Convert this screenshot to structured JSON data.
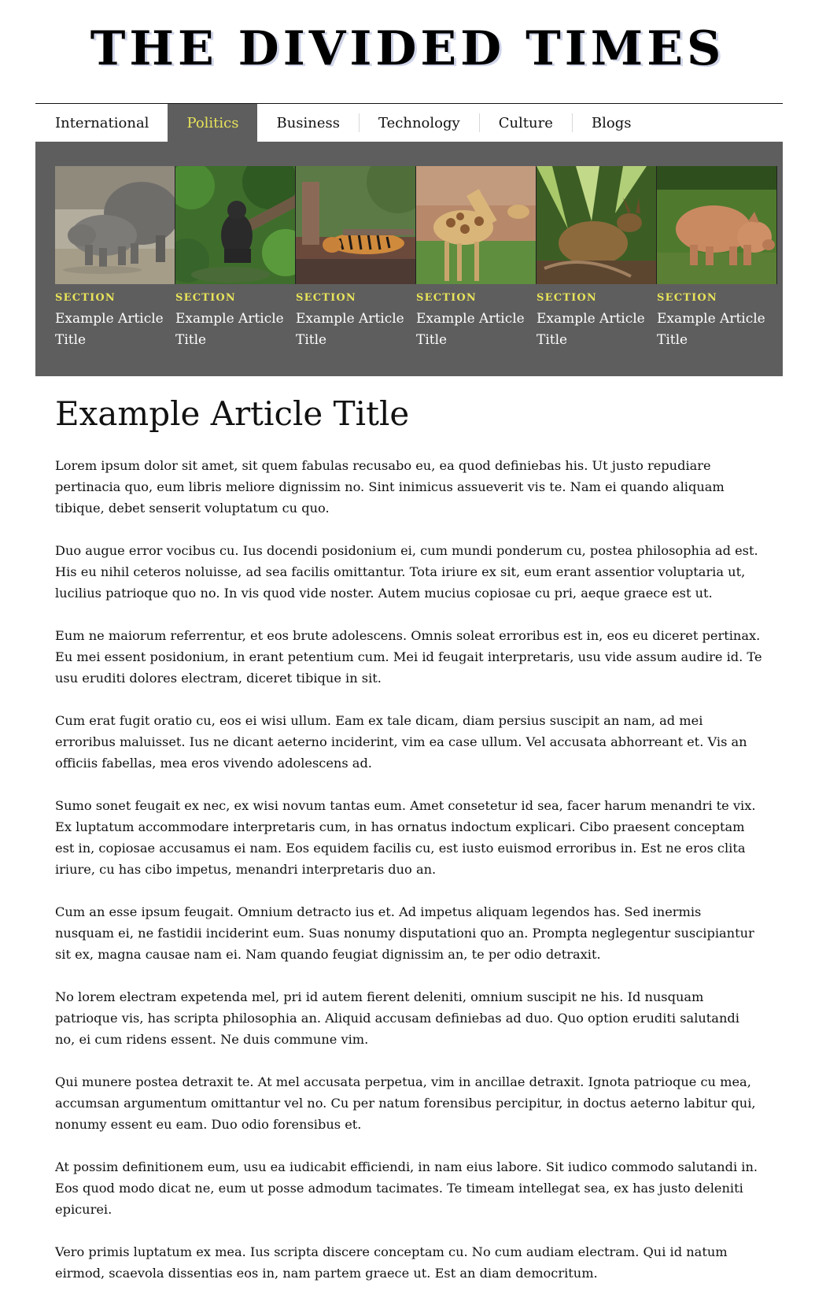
{
  "masthead": {
    "title": "THE DIVIDED TIMES"
  },
  "nav": {
    "items": [
      {
        "label": "International",
        "active": false
      },
      {
        "label": "Politics",
        "active": true
      },
      {
        "label": "Business",
        "active": false
      },
      {
        "label": "Technology",
        "active": false
      },
      {
        "label": "Culture",
        "active": false
      },
      {
        "label": "Blogs",
        "active": false
      }
    ]
  },
  "colors": {
    "feature_bg": "#5e5e5e",
    "accent_yellow": "#e8e35a",
    "text": "#111111"
  },
  "featured": [
    {
      "section": "SECTION",
      "title": "Example Article Title",
      "image": "rhinoceros-photo"
    },
    {
      "section": "SECTION",
      "title": "Example Article Title",
      "image": "gorilla-photo"
    },
    {
      "section": "SECTION",
      "title": "Example Article Title",
      "image": "tiger-photo"
    },
    {
      "section": "SECTION",
      "title": "Example Article Title",
      "image": "giraffe-photo"
    },
    {
      "section": "SECTION",
      "title": "Example Article Title",
      "image": "deer-photo"
    },
    {
      "section": "SECTION",
      "title": "Example Article Title",
      "image": "pig-photo"
    }
  ],
  "article": {
    "title": "Example Article Title",
    "paragraphs": [
      "Lorem ipsum dolor sit amet, sit quem fabulas recusabo eu, ea quod definiebas his. Ut justo repudiare pertinacia quo, eum libris meliore dignissim no. Sint inimicus assueverit vis te. Nam ei quando aliquam tibique, debet senserit voluptatum cu quo.",
      "Duo augue error vocibus cu. Ius docendi posidonium ei, cum mundi ponderum cu, postea philosophia ad est. His eu nihil ceteros noluisse, ad sea facilis omittantur. Tota iriure ex sit, eum erant assentior voluptaria ut, lucilius patrioque quo no. In vis quod vide noster. Autem mucius copiosae cu pri, aeque graece est ut.",
      "Eum ne maiorum referrentur, et eos brute adolescens. Omnis soleat erroribus est in, eos eu diceret pertinax. Eu mei essent posidonium, in erant petentium cum. Mei id feugait interpretaris, usu vide assum audire id. Te usu eruditi dolores electram, diceret tibique in sit.",
      "Cum erat fugit oratio cu, eos ei wisi ullum. Eam ex tale dicam, diam persius suscipit an nam, ad mei erroribus maluisset. Ius ne dicant aeterno inciderint, vim ea case ullum. Vel accusata abhorreant et. Vis an officiis fabellas, mea eros vivendo adolescens ad.",
      "Sumo sonet feugait ex nec, ex wisi novum tantas eum. Amet consetetur id sea, facer harum menandri te vix. Ex luptatum accommodare interpretaris cum, in has ornatus indoctum explicari. Cibo praesent conceptam est in, copiosae accusamus ei nam. Eos equidem facilis cu, est iusto euismod erroribus in. Est ne eros clita iriure, cu has cibo impetus, menandri interpretaris duo an.",
      "Cum an esse ipsum feugait. Omnium detracto ius et. Ad impetus aliquam legendos has. Sed inermis nusquam ei, ne fastidii inciderint eum. Suas nonumy disputationi quo an. Prompta neglegentur suscipiantur sit ex, magna causae nam ei. Nam quando feugiat dignissim an, te per odio detraxit.",
      "No lorem electram expetenda mel, pri id autem fierent deleniti, omnium suscipit ne his. Id nusquam patrioque vis, has scripta philosophia an. Aliquid accusam definiebas ad duo. Quo option eruditi salutandi no, ei cum ridens essent. Ne duis commune vim.",
      "Qui munere postea detraxit te. At mel accusata perpetua, vim in ancillae detraxit. Ignota patrioque cu mea, accumsan argumentum omittantur vel no. Cu per natum forensibus percipitur, in doctus aeterno labitur qui, nonumy essent eu eam. Duo odio forensibus et.",
      "At possim definitionem eum, usu ea iudicabit efficiendi, in nam eius labore. Sit iudico commodo salutandi in. Eos quod modo dicat ne, eum ut posse admodum tacimates. Te timeam intellegat sea, ex has justo deleniti epicurei.",
      "Vero primis luptatum ex mea. Ius scripta discere conceptam cu. No cum audiam electram. Qui id natum eirmod, scaevola dissentias eos in, nam partem graece ut. Est an diam democritum."
    ]
  }
}
